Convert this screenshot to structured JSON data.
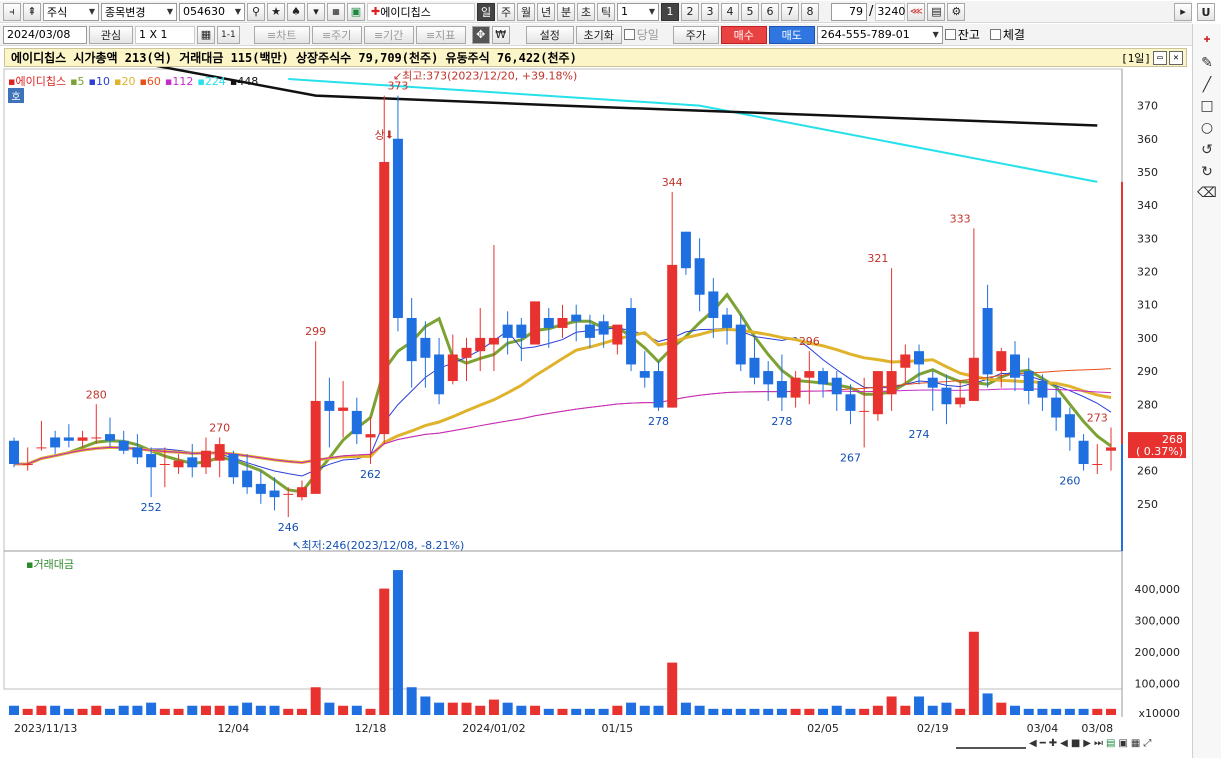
{
  "toolbar1": {
    "market_type": "주식",
    "stock_change": "종목변경",
    "code": "054630",
    "stock_name": "에이디칩스",
    "period_units": [
      "일",
      "주",
      "월",
      "년",
      "분",
      "초",
      "틱"
    ],
    "period_num": "1",
    "n_buttons": [
      "1",
      "2",
      "3",
      "4",
      "5",
      "6",
      "7",
      "8"
    ],
    "count_value": "79",
    "count_sep": "/",
    "count_total": "3240",
    "u_label": "U"
  },
  "toolbar2": {
    "date": "2024/03/08",
    "interest": "관심",
    "layout": "1 X 1",
    "layout2": "1-1",
    "chart_btn": "≡차트",
    "main_btn": "≡주기",
    "term_btn": "≡기간",
    "index_btn": "≡지표",
    "won": "₩",
    "settings": "설정",
    "reset": "초기화",
    "same_day": "당일",
    "price": "주가",
    "buy": "매수",
    "sell": "매도",
    "account": "264-555-789-01",
    "balance": "잔고",
    "execution": "체결"
  },
  "info_bar": {
    "text": "에이디칩스  시가총액 213(억)  거래대금 115(백만)  상장주식수 79,709(천주)  유동주식 76,422(천주)",
    "period_tag": "[1일]"
  },
  "legend": {
    "stock": "에이디칩스",
    "ma": [
      {
        "label": "5",
        "color": "#7ba232"
      },
      {
        "label": "10",
        "color": "#2a3ed8"
      },
      {
        "label": "20",
        "color": "#e0b32c"
      },
      {
        "label": "60",
        "color": "#e84f1b"
      },
      {
        "label": "112",
        "color": "#c42cc8"
      },
      {
        "label": "224",
        "color": "#26e0ea"
      },
      {
        "label": "448",
        "color": "#111111"
      }
    ],
    "badge": "호"
  },
  "annotations": {
    "high": "최고:373(2023/12/20, +39.18%)",
    "low": "최저:246(2023/12/08, -8.21%)",
    "upper_limit": "상",
    "current_price": "268",
    "current_change": "( 0.37%)"
  },
  "volume_legend": "거래대금",
  "chart_data": {
    "type": "candlestick",
    "price_axis": {
      "min": 240,
      "max": 375,
      "ticks": [
        250,
        260,
        270,
        280,
        290,
        300,
        310,
        320,
        330,
        340,
        350,
        360,
        370
      ]
    },
    "volume_axis": {
      "ticks": [
        "400,000",
        "300,000",
        "200,000",
        "100,000"
      ],
      "unit": "x10000",
      "max": 470000
    },
    "date_labels": [
      "2023/11/13",
      "12/04",
      "12/18",
      "2024/01/02",
      "01/15",
      "02/05",
      "02/19",
      "03/04",
      "03/08"
    ],
    "date_label_index": [
      0,
      16,
      26,
      35,
      44,
      59,
      67,
      75,
      79
    ],
    "price_labels": [
      {
        "i": 6,
        "v": 280,
        "c": "red",
        "pos": "above"
      },
      {
        "i": 10,
        "v": 252,
        "c": "blue",
        "pos": "below"
      },
      {
        "i": 15,
        "v": 270,
        "c": "red",
        "pos": "above"
      },
      {
        "i": 20,
        "v": 246,
        "c": "blue",
        "pos": "below"
      },
      {
        "i": 22,
        "v": 299,
        "c": "red",
        "pos": "above"
      },
      {
        "i": 26,
        "v": 262,
        "c": "blue",
        "pos": "below"
      },
      {
        "i": 28,
        "v": 373,
        "c": "red",
        "pos": "above"
      },
      {
        "i": 47,
        "v": 278,
        "c": "blue",
        "pos": "below"
      },
      {
        "i": 48,
        "v": 344,
        "c": "red",
        "pos": "above"
      },
      {
        "i": 56,
        "v": 278,
        "c": "blue",
        "pos": "below"
      },
      {
        "i": 58,
        "v": 296,
        "c": "red",
        "pos": "above"
      },
      {
        "i": 61,
        "v": 267,
        "c": "blue",
        "pos": "below"
      },
      {
        "i": 63,
        "v": 321,
        "c": "red",
        "pos": "above"
      },
      {
        "i": 66,
        "v": 274,
        "c": "blue",
        "pos": "below"
      },
      {
        "i": 69,
        "v": 333,
        "c": "red",
        "pos": "above"
      },
      {
        "i": 77,
        "v": 260,
        "c": "blue",
        "pos": "below"
      },
      {
        "i": 79,
        "v": 273,
        "c": "red",
        "pos": "above"
      }
    ],
    "candles": [
      [
        269,
        270,
        262,
        261,
        3
      ],
      [
        262,
        267,
        262,
        260,
        2
      ],
      [
        267,
        275,
        267,
        266,
        3
      ],
      [
        270,
        272,
        267,
        265,
        3
      ],
      [
        270,
        274,
        269,
        267,
        2
      ],
      [
        269,
        272,
        270,
        267,
        2
      ],
      [
        270,
        280,
        270,
        268,
        3
      ],
      [
        271,
        276,
        269,
        267,
        2
      ],
      [
        269,
        272,
        266,
        265,
        3
      ],
      [
        267,
        271,
        264,
        262,
        3
      ],
      [
        265,
        267,
        261,
        252,
        4
      ],
      [
        262,
        267,
        262,
        255,
        2
      ],
      [
        261,
        265,
        263,
        259,
        2
      ],
      [
        264,
        268,
        261,
        258,
        3
      ],
      [
        261,
        270,
        266,
        259,
        3
      ],
      [
        263,
        270,
        268,
        258,
        3
      ],
      [
        265,
        266,
        258,
        256,
        3
      ],
      [
        260,
        265,
        255,
        253,
        4
      ],
      [
        256,
        260,
        253,
        250,
        3
      ],
      [
        254,
        258,
        252,
        248,
        3
      ],
      [
        253,
        255,
        253,
        246,
        2
      ],
      [
        252,
        257,
        255,
        251,
        2
      ],
      [
        253,
        299,
        281,
        253,
        9
      ],
      [
        281,
        288,
        278,
        267,
        4
      ],
      [
        278,
        287,
        279,
        270,
        3
      ],
      [
        278,
        282,
        271,
        268,
        3
      ],
      [
        270,
        276,
        271,
        262,
        2
      ],
      [
        271,
        373,
        353,
        268,
        41
      ],
      [
        360,
        373,
        306,
        302,
        47
      ],
      [
        306,
        312,
        293,
        285,
        9
      ],
      [
        300,
        305,
        294,
        285,
        6
      ],
      [
        295,
        300,
        283,
        280,
        4
      ],
      [
        287,
        301,
        295,
        286,
        4
      ],
      [
        294,
        300,
        297,
        287,
        4
      ],
      [
        296,
        309,
        300,
        290,
        3
      ],
      [
        298,
        328,
        300,
        290,
        5
      ],
      [
        304,
        308,
        300,
        295,
        4
      ],
      [
        304,
        306,
        300,
        293,
        3
      ],
      [
        298,
        306,
        311,
        298,
        3
      ],
      [
        306,
        309,
        303,
        297,
        2
      ],
      [
        303,
        310,
        306,
        300,
        2
      ],
      [
        307,
        310,
        305,
        299,
        2
      ],
      [
        304,
        307,
        300,
        297,
        2
      ],
      [
        305,
        307,
        301,
        297,
        2
      ],
      [
        298,
        303,
        304,
        295,
        3
      ],
      [
        309,
        312,
        292,
        290,
        4
      ],
      [
        290,
        296,
        288,
        285,
        3
      ],
      [
        290,
        293,
        279,
        278,
        3
      ],
      [
        279,
        344,
        322,
        279,
        17
      ],
      [
        332,
        332,
        321,
        319,
        4
      ],
      [
        324,
        330,
        313,
        308,
        3
      ],
      [
        314,
        318,
        306,
        300,
        2
      ],
      [
        307,
        309,
        303,
        298,
        2
      ],
      [
        304,
        307,
        292,
        290,
        2
      ],
      [
        294,
        300,
        288,
        286,
        2
      ],
      [
        290,
        293,
        286,
        281,
        2
      ],
      [
        287,
        295,
        282,
        278,
        2
      ],
      [
        282,
        290,
        288,
        279,
        2
      ],
      [
        288,
        296,
        290,
        280,
        2
      ],
      [
        290,
        291,
        286,
        282,
        2
      ],
      [
        288,
        290,
        283,
        278,
        3
      ],
      [
        283,
        286,
        278,
        274,
        2
      ],
      [
        278,
        288,
        278,
        267,
        2
      ],
      [
        277,
        290,
        290,
        275,
        3
      ],
      [
        283,
        321,
        290,
        278,
        6
      ],
      [
        291,
        298,
        295,
        286,
        3
      ],
      [
        296,
        298,
        292,
        286,
        6
      ],
      [
        288,
        290,
        285,
        278,
        3
      ],
      [
        285,
        289,
        280,
        274,
        4
      ],
      [
        280,
        287,
        282,
        279,
        2
      ],
      [
        281,
        333,
        294,
        281,
        27
      ],
      [
        309,
        316,
        289,
        285,
        7
      ],
      [
        290,
        297,
        296,
        285,
        4
      ],
      [
        295,
        299,
        288,
        284,
        3
      ],
      [
        290,
        294,
        284,
        280,
        2
      ],
      [
        287,
        289,
        282,
        278,
        2
      ],
      [
        282,
        285,
        276,
        272,
        2
      ],
      [
        277,
        279,
        270,
        266,
        2
      ],
      [
        269,
        271,
        262,
        260,
        2
      ],
      [
        262,
        268,
        262,
        259,
        2
      ],
      [
        266,
        273,
        267,
        260,
        2
      ]
    ]
  }
}
